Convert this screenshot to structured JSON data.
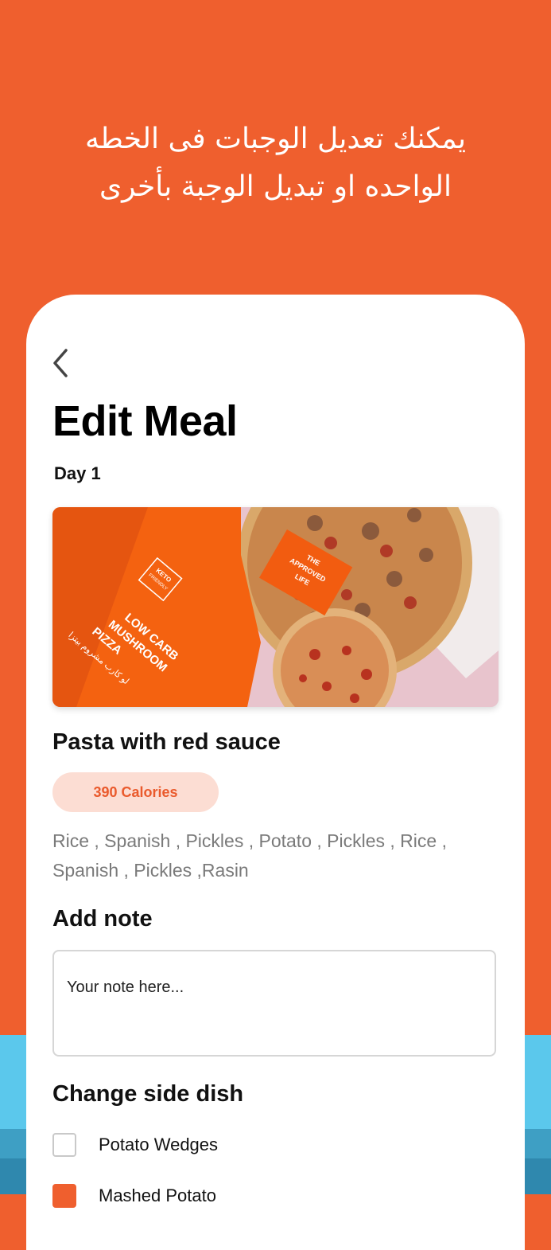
{
  "promo": {
    "headline_line1": "يمكنك تعديل الوجبات فى الخطه",
    "headline_line2": "الواحده او تبديل الوجبة بأخرى"
  },
  "screen": {
    "title": "Edit Meal",
    "day_label": "Day 1"
  },
  "meal": {
    "image": {
      "description": "low-carb-mushroom-pizza-box",
      "box_badge_line1": "KETO",
      "box_badge_line2": "FRIENDLY",
      "box_text_line1": "LOW CARB",
      "box_text_line2": "MUSHROOM",
      "box_text_line3": "PIZZA",
      "box_arabic": "لو كارب مشروم بيتزا",
      "tag_line1": "THE",
      "tag_line2": "APPROVED",
      "tag_line3": "LIFE"
    },
    "name": "Pasta with red sauce",
    "calories": "390 Calories",
    "ingredients_line1": "Rice , Spanish , Pickles , Potato , Pickles , Rice ,",
    "ingredients_line2": "Spanish , Pickles ,Rasin"
  },
  "note": {
    "title": "Add note",
    "placeholder": "Your note here..."
  },
  "side_dish": {
    "title": "Change side dish",
    "options": [
      {
        "label": "Potato Wedges",
        "checked": false
      },
      {
        "label": "Mashed Potato",
        "checked": true
      }
    ]
  },
  "colors": {
    "brand_orange": "#EF5F2E",
    "pill_bg": "#FCDDD3",
    "accent_blue": "#5BC8EC"
  }
}
